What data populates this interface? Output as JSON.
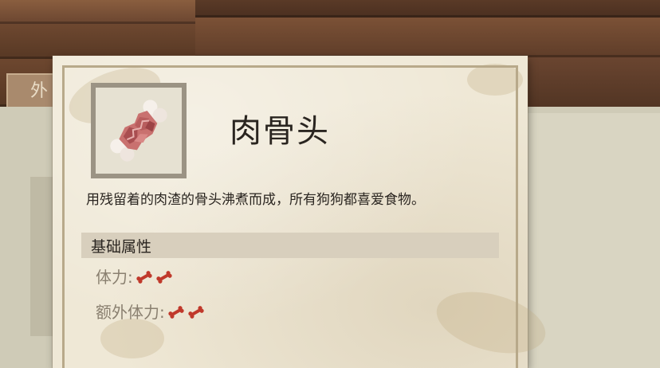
{
  "background": {
    "tab_label": "外"
  },
  "item": {
    "name": "肉骨头",
    "icon": "meat-bone-icon",
    "description": "用残留着的肉渣的骨头沸煮而成，所有狗狗都喜爱食物。"
  },
  "attributes": {
    "header": "基础属性",
    "rows": [
      {
        "label": "体力:",
        "value": 2,
        "icon": "mini-bone-icon"
      },
      {
        "label": "额外体力:",
        "value": 2,
        "icon": "mini-bone-icon"
      }
    ]
  },
  "colors": {
    "parchment": "#efe8d6",
    "bone_red": "#c0392b",
    "label_gray": "#8a8070",
    "text_dark": "#2a2520"
  }
}
